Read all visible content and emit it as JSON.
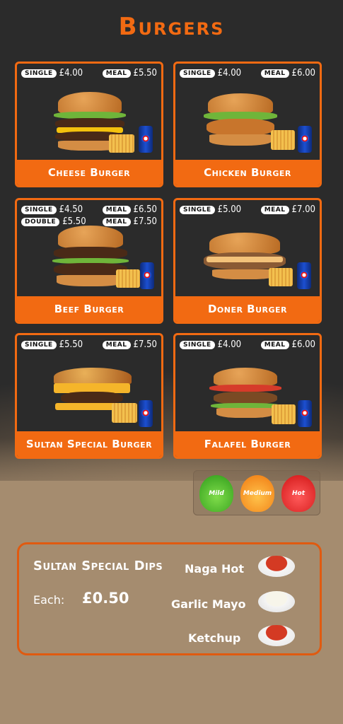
{
  "title": "Burgers",
  "brand_color": "#f26a12",
  "cards": [
    {
      "name": "Cheese Burger",
      "prices": [
        [
          {
            "tag": "SINGLE",
            "amt": "£4.00"
          },
          {
            "tag": "MEAL",
            "amt": "£5.50"
          }
        ]
      ]
    },
    {
      "name": "Chicken Burger",
      "prices": [
        [
          {
            "tag": "SINGLE",
            "amt": "£4.00"
          },
          {
            "tag": "MEAL",
            "amt": "£6.00"
          }
        ]
      ]
    },
    {
      "name": "Beef Burger",
      "prices": [
        [
          {
            "tag": "SINGLE",
            "amt": "£4.50"
          },
          {
            "tag": "MEAL",
            "amt": "£6.50"
          }
        ],
        [
          {
            "tag": "DOUBLE",
            "amt": "£5.50"
          },
          {
            "tag": "MEAL",
            "amt": "£7.50"
          }
        ]
      ]
    },
    {
      "name": "Doner Burger",
      "prices": [
        [
          {
            "tag": "SINGLE",
            "amt": "£5.00"
          },
          {
            "tag": "MEAL",
            "amt": "£7.00"
          }
        ]
      ]
    },
    {
      "name": "Sultan Special Burger",
      "prices": [
        [
          {
            "tag": "SINGLE",
            "amt": "£5.50"
          },
          {
            "tag": "MEAL",
            "amt": "£7.50"
          }
        ]
      ]
    },
    {
      "name": "Falafel Burger",
      "prices": [
        [
          {
            "tag": "SINGLE",
            "amt": "£4.00"
          },
          {
            "tag": "MEAL",
            "amt": "£6.00"
          }
        ]
      ]
    }
  ],
  "spice": {
    "mild": "Mild",
    "medium": "Medium",
    "hot": "Hot"
  },
  "dips": {
    "title": "Sultan Special Dips",
    "each_label": "Each:",
    "each_price": "£0.50",
    "items": [
      "Naga Hot",
      "Garlic Mayo",
      "Ketchup"
    ]
  }
}
